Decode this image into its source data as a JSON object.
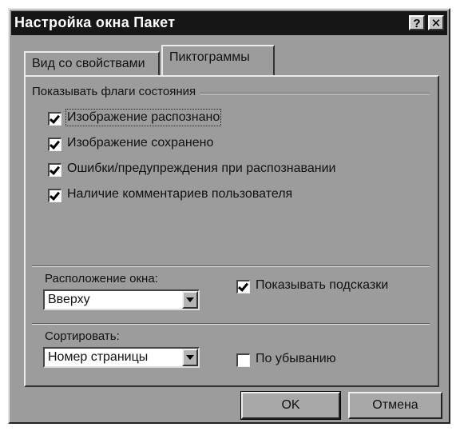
{
  "window": {
    "title": "Настройка окна Пакет",
    "help_label": "?",
    "close_label": "✕"
  },
  "tabs": [
    {
      "label": "Вид со свойствами",
      "active": false
    },
    {
      "label": "Пиктограммы",
      "active": true
    }
  ],
  "status_flags": {
    "group_label": "Показывать флаги состояния",
    "items": [
      {
        "label": "Изображение распознано",
        "checked": true
      },
      {
        "label": "Изображение сохранено",
        "checked": true
      },
      {
        "label": "Ошибки/предупреждения при распознавании",
        "checked": true
      },
      {
        "label": "Наличие комментариев пользователя",
        "checked": true
      }
    ]
  },
  "window_position": {
    "label": "Расположение окна:",
    "value": "Вверху"
  },
  "show_hints": {
    "label": "Показывать подсказки",
    "checked": true
  },
  "sort": {
    "label": "Сортировать:",
    "value": "Номер страницы",
    "descending": {
      "label": "По убыванию",
      "checked": false
    }
  },
  "buttons": {
    "ok": "OK",
    "cancel": "Отмена"
  }
}
